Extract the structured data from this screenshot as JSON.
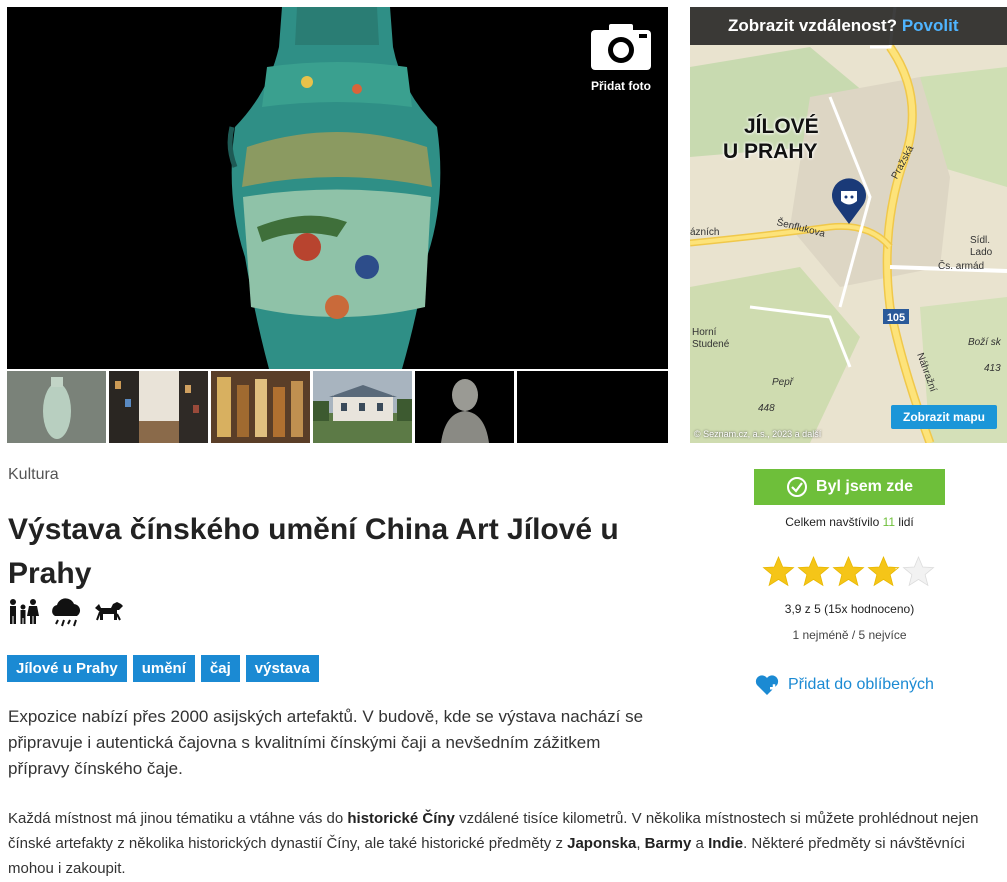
{
  "gallery": {
    "add_photo_label": "Přidat foto"
  },
  "map": {
    "distance_prompt": "Zobrazit vzdálenost?",
    "allow_label": "Povolit",
    "city_line1": "JÍLOVÉ",
    "city_line2": "U PRAHY",
    "show_map_label": "Zobrazit mapu",
    "copyright": "© Seznam.cz, a.s., 2023 a další",
    "labels": {
      "street1": "Šenflukova",
      "street2": "Pražská",
      "street3": "Náhražní",
      "place1": "Sídl. Lado",
      "place2": "Čs. armád",
      "place3": "Horní Studené",
      "place4": "Pepř",
      "alt1": "448",
      "place5": "Boží sk",
      "alt2": "413",
      "road": "105",
      "left_street": "ázních"
    }
  },
  "page": {
    "category": "Kultura",
    "title": "Výstava čínského umění China Art Jílové u Prahy",
    "tags": [
      "Jílové u Prahy",
      "umění",
      "čaj",
      "výstava"
    ],
    "lead": "Expozice nabízí přes 2000 asijských artefaktů. V budově, kde se výstava nachází se připravuje i autentická čajovna s kvalitními čínskými čaji a nevšedním zážitkem přípravy čínského čaje.",
    "desc": {
      "p1": "Každá místnost má jinou tématiku a vtáhne vás do ",
      "b1": "historické Číny",
      "p2": " vzdálené tisíce kilometrů. V několika místnostech si můžete prohlédnout nejen čínské artefakty z několika historických dynastií Číny, ale také historické předměty z ",
      "b2": "Japonska",
      "p3": ", ",
      "b3": "Barmy",
      "p4": " a ",
      "b4": "Indie",
      "p5": ". Některé předměty si návštěvníci mohou i zakoupit."
    }
  },
  "sidebar": {
    "visited_label": "Byl jsem zde",
    "visited_prefix": "Celkem navštívilo ",
    "visited_count": "11",
    "visited_suffix": " lidí",
    "rating": 3.9,
    "rating_text": "3,9 z 5 (15x hodnoceno)",
    "rating_scale": "1 nejméně / 5 nejvíce",
    "favorite_label": "Přidat do oblíbených"
  },
  "colors": {
    "accent_blue": "#1b8ad3",
    "visited_green": "#6ebf3a",
    "star_gold": "#f5c518",
    "map_pin": "#1a3a78"
  },
  "icons": [
    "camera-icon",
    "family-icon",
    "rain-cloud-icon",
    "dog-icon",
    "check-circle-icon",
    "star-icon",
    "heart-plus-icon",
    "map-pin-icon"
  ]
}
